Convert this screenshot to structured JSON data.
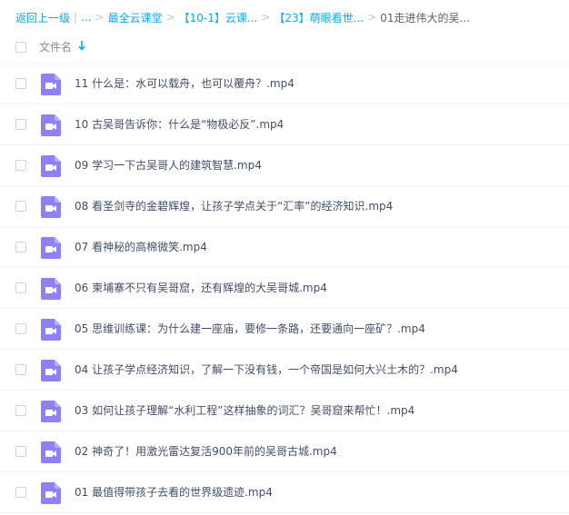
{
  "breadcrumb": {
    "back": "返回上一级",
    "ellipsis": "...",
    "items": [
      "最全云课堂",
      "【10-1】云课...",
      "【23】萌眼看世..."
    ],
    "current": "01走进伟大的吴...",
    "separator": ">",
    "divider": "|"
  },
  "header": {
    "column_name": "文件名"
  },
  "files": [
    "11 什么是：水可以载舟，也可以覆舟？.mp4",
    "10 古吴哥告诉你：什么是“物极必反”.mp4",
    "09 学习一下古吴哥人的建筑智慧.mp4",
    "08 看圣剑寺的金碧辉煌，让孩子学点关于“汇率”的经济知识.mp4",
    "07 看神秘的高棉微笑.mp4",
    "06 柬埔寨不只有吴哥窟，还有辉煌的大吴哥城.mp4",
    "05 思维训练课：为什么建一座庙，要修一条路，还要通向一座矿？.mp4",
    "04 让孩子学点经济知识，了解一下没有钱，一个帝国是如何大兴土木的？.mp4",
    "03 如何让孩子理解“水利工程”这样抽象的词汇？吴哥窟来帮忙！.mp4",
    "02 神奇了！用激光雷达复活900年前的吴哥古城.mp4",
    "01 最值得带孩子去看的世界级遗迹.mp4"
  ],
  "colors": {
    "accent": "#09aaff",
    "video_icon": "#8c82f5"
  },
  "icons": {
    "file": "video-file-icon",
    "sort": "sort-down-arrow-icon"
  }
}
